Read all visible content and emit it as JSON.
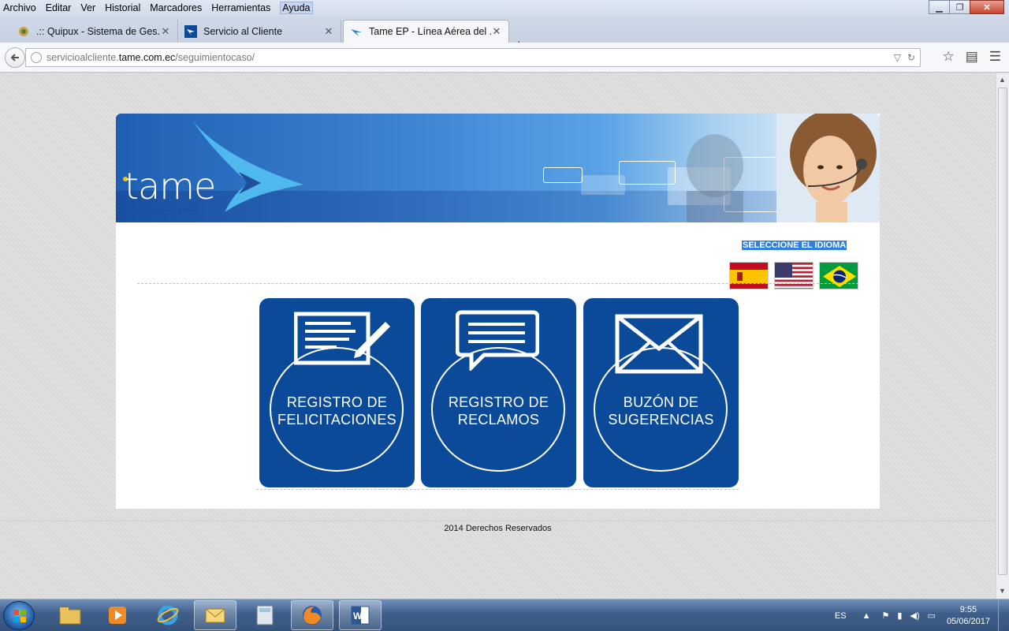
{
  "menu": [
    "Archivo",
    "Editar",
    "Ver",
    "Historial",
    "Marcadores",
    "Herramientas",
    "Ayuda"
  ],
  "tabs": [
    {
      "title": ".:: Quipux - Sistema de Ges..."
    },
    {
      "title": "Servicio al Cliente"
    },
    {
      "title": "Tame EP - Línea Aérea del ..."
    }
  ],
  "url": {
    "host_prefix": "servicioalcliente.",
    "host": "tame.com.ec",
    "path": "/seguimientocaso/"
  },
  "page": {
    "logo": {
      "word": "tame",
      "tagline": "VUELA ECUADOR"
    },
    "language_prompt": "SELECCIONE EL IDIOMA",
    "flags": [
      "spain-flag",
      "usa-flag",
      "brazil-flag"
    ],
    "tiles": [
      {
        "line1": "REGISTRO DE",
        "line2": "FELICITACIONES"
      },
      {
        "line1": "REGISTRO DE",
        "line2": "RECLAMOS"
      },
      {
        "line1": "BUZÓN DE",
        "line2": "SUGERENCIAS"
      }
    ],
    "footer": "2014 Derechos Reservados",
    "colors": {
      "brand_blue": "#0a4a98",
      "highlight": "#2f7fe0"
    }
  },
  "taskbar": {
    "language": "ES",
    "time": "9:55",
    "date": "05/06/2017",
    "apps": [
      "file-explorer",
      "media-player",
      "internet-explorer",
      "outlook",
      "calculator",
      "firefox",
      "word"
    ]
  }
}
